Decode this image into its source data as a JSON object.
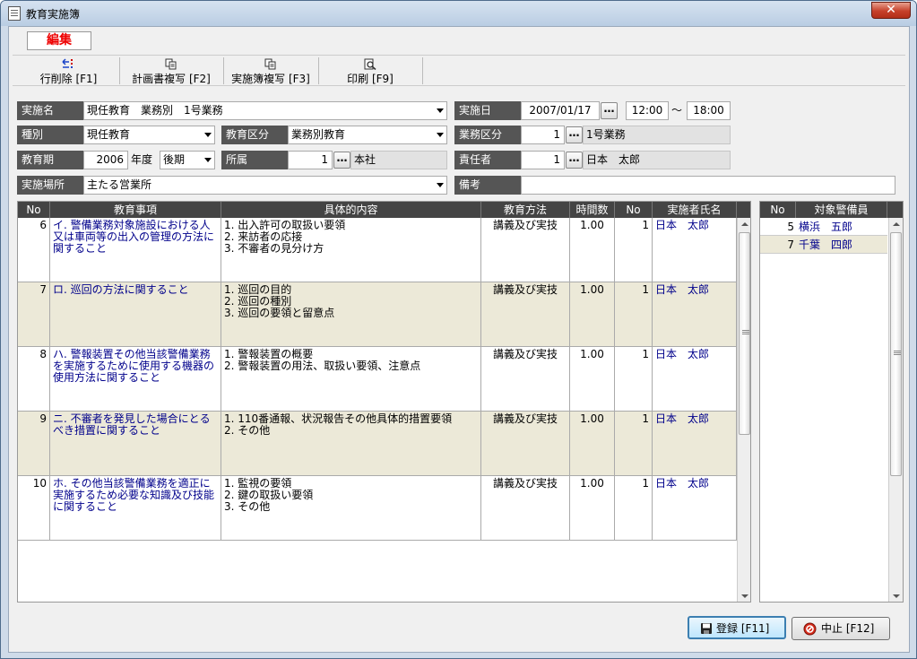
{
  "window": {
    "title": "教育実施簿",
    "close_label": "✕"
  },
  "mode_label": "編集",
  "toolbar": [
    {
      "label": "行削除 [F1]",
      "icon": "delete-row-icon"
    },
    {
      "label": "計画書複写 [F2]",
      "icon": "copy-icon"
    },
    {
      "label": "実施簿複写 [F3]",
      "icon": "copy-icon"
    },
    {
      "label": "印刷 [F9]",
      "icon": "print-preview-icon"
    }
  ],
  "form": {
    "jisshi_name": {
      "label": "実施名",
      "value": "現任教育　業務別　1号業務"
    },
    "jisshi_date": {
      "label": "実施日",
      "date": "2007/01/17",
      "start": "12:00",
      "tilde": "～",
      "end": "18:00"
    },
    "shubetsu": {
      "label": "種別",
      "value": "現任教育"
    },
    "kyoiku_kubun": {
      "label": "教育区分",
      "value": "業務別教育"
    },
    "gyomu_kubun": {
      "label": "業務区分",
      "code": "1",
      "name": "1号業務"
    },
    "kyoiku_ki": {
      "label": "教育期",
      "year": "2006",
      "year_unit": "年度",
      "term": "後期"
    },
    "shozoku": {
      "label": "所属",
      "code": "1",
      "name": "本社"
    },
    "sekinin": {
      "label": "責任者",
      "code": "1",
      "name": "日本　太郎"
    },
    "basho": {
      "label": "実施場所",
      "value": "主たる営業所"
    },
    "biko": {
      "label": "備考",
      "value": ""
    },
    "ellipsis": "…"
  },
  "main_grid": {
    "headers": [
      "No",
      "教育事項",
      "具体的内容",
      "教育方法",
      "時間数",
      "No",
      "実施者氏名"
    ],
    "rows": [
      {
        "no": "6",
        "item": "イ. 警備業務対象施設における人又は車両等の出入の管理の方法に関すること",
        "content": "1. 出入許可の取扱い要領\n2. 来訪者の応接\n3. 不審者の見分け方",
        "method": "講義及び実技",
        "hours": "1.00",
        "staff_no": "1",
        "staff": "日本　太郎"
      },
      {
        "no": "7",
        "item": "ロ. 巡回の方法に関すること",
        "content": "1. 巡回の目的\n2. 巡回の種別\n3. 巡回の要領と留意点",
        "method": "講義及び実技",
        "hours": "1.00",
        "staff_no": "1",
        "staff": "日本　太郎"
      },
      {
        "no": "8",
        "item": "ハ. 警報装置その他当該警備業務を実施するために使用する機器の使用方法に関すること",
        "content": "1. 警報装置の概要\n2. 警報装置の用法、取扱い要領、注意点",
        "method": "講義及び実技",
        "hours": "1.00",
        "staff_no": "1",
        "staff": "日本　太郎"
      },
      {
        "no": "9",
        "item": "ニ. 不審者を発見した場合にとるべき措置に関すること",
        "content": "1. 110番通報、状況報告その他具体的措置要領\n2. その他",
        "method": "講義及び実技",
        "hours": "1.00",
        "staff_no": "1",
        "staff": "日本　太郎"
      },
      {
        "no": "10",
        "item": "ホ. その他当該警備業務を適正に実施するため必要な知識及び技能に関すること",
        "content": "1. 監視の要領\n2. 鍵の取扱い要領\n3. その他",
        "method": "講義及び実技",
        "hours": "1.00",
        "staff_no": "1",
        "staff": "日本　太郎"
      }
    ]
  },
  "side_grid": {
    "headers": [
      "No",
      "対象警備員"
    ],
    "rows": [
      {
        "no": "5",
        "name": "横浜　五郎"
      },
      {
        "no": "7",
        "name": "千葉　四郎"
      }
    ]
  },
  "buttons": {
    "register": "登録 [F11]",
    "cancel": "中止 [F12]"
  },
  "colors": {
    "label_bg": "#555555",
    "alt_row": "#ece9d8",
    "link_text": "#00008b",
    "mode_text": "#ee0000"
  }
}
